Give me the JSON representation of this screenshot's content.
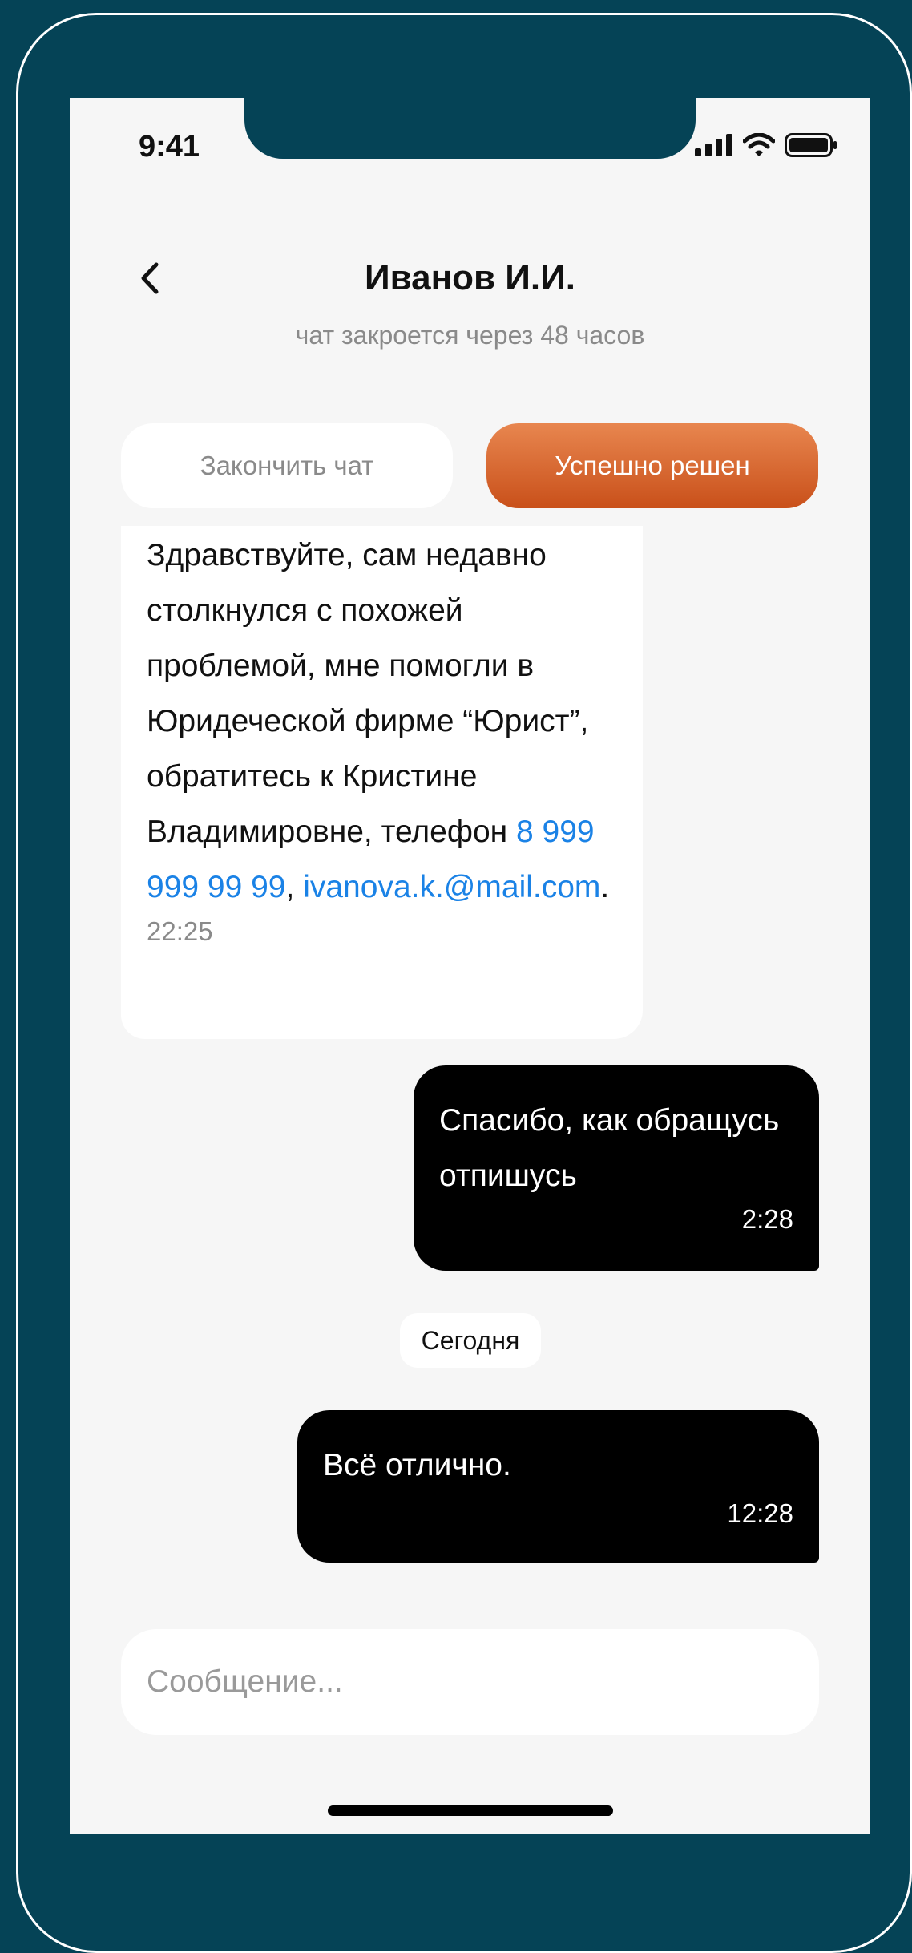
{
  "status_bar": {
    "time": "9:41"
  },
  "header": {
    "title": "Иванов И.И.",
    "subtitle": "чат закроется через 48 часов"
  },
  "actions": {
    "end_chat_label": "Закончить чат",
    "resolved_label": "Успешно решен"
  },
  "messages": {
    "incoming": {
      "text_before": "Здравствуйте, сам недавно столкнулся с похожей проблемой, мне помогли в Юридеческой фирме “Юрист”, обратитесь к Кристине Владимировне, телефон ",
      "phone": "8 999 999 99 99",
      "separator": ",",
      "email": "ivanova.k.@mail.com",
      "end": ".",
      "time": "22:25"
    },
    "outgoing_1": {
      "text": "Спасибо, как обращусь отпишусь",
      "time": "2:28"
    },
    "date_divider": "Сегодня",
    "outgoing_2": {
      "text": "Всё отлично.",
      "time": "12:28"
    }
  },
  "composer": {
    "placeholder": "Сообщение..."
  },
  "colors": {
    "background": "#054356",
    "accent_gradient_top": "#e8864f",
    "accent_gradient_bottom": "#c9501a",
    "link": "#1a82e6"
  },
  "icons": {
    "back": "chevron-left-icon",
    "signal": "signal-bars-icon",
    "wifi": "wifi-icon",
    "battery": "battery-icon"
  }
}
